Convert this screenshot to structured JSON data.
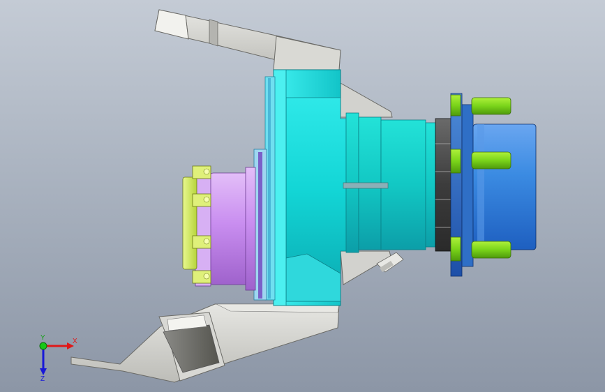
{
  "viewport": {
    "background_top": "#c4cbd5",
    "background_bottom": "#8c96a6"
  },
  "model": {
    "parts": [
      {
        "name": "steering-knuckle-upper-arm",
        "color": "#d0d0cc"
      },
      {
        "name": "steering-knuckle-lower-arm",
        "color": "#d0d0cc"
      },
      {
        "name": "knuckle-body",
        "color": "#22dcdc"
      },
      {
        "name": "brake-disc",
        "color": "#2fbdcf"
      },
      {
        "name": "hub-shaft",
        "color": "#1ec6c6"
      },
      {
        "name": "bearing-nut",
        "color": "#4a4a4a"
      },
      {
        "name": "wheel-hub-flange",
        "color": "#3a8fe0"
      },
      {
        "name": "wheel-studs",
        "color": "#7ad61e"
      },
      {
        "name": "drive-flange",
        "color": "#c88ef0"
      },
      {
        "name": "drive-flange-bolts",
        "color": "#d6ef5a"
      }
    ]
  },
  "triad": {
    "x_label": "X",
    "y_label": "Y",
    "z_label": "Z",
    "x_color": "#e01818",
    "y_color": "#18c818",
    "z_color": "#1818d8"
  }
}
